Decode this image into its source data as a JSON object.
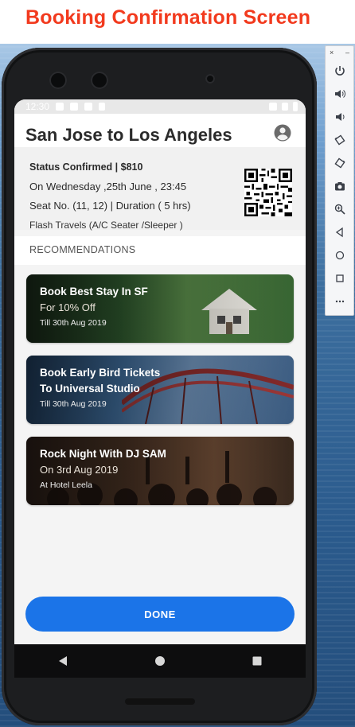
{
  "page_title": "Booking Confirmation Screen",
  "colors": {
    "title_red": "#f23a1e",
    "accent_blue": "#1b74e8"
  },
  "status_bar": {
    "time": "12:30"
  },
  "header": {
    "route": "San Jose to Los Angeles",
    "account_icon": "account-circle-icon"
  },
  "booking": {
    "status_line": "Status Confirmed | $810",
    "date_line": "On Wednesday ,25th June , 23:45",
    "seat_line": "Seat No. (11, 12) | Duration ( 5 hrs)",
    "operator_line": "Flash Travels (A/C Seater /Sleeper )",
    "qr_icon": "qr-code-icon"
  },
  "recommendations": {
    "label": "RECOMMENDATIONS",
    "cards": [
      {
        "title": "Book Best Stay In SF",
        "subtitle": "For 10% Off",
        "detail": "Till 30th Aug 2019"
      },
      {
        "title": "Book Early Bird Tickets",
        "subtitle": "To Universal Studio",
        "detail": "Till 30th Aug 2019"
      },
      {
        "title": "Rock Night With DJ SAM",
        "subtitle": "On 3rd Aug 2019",
        "detail": "At Hotel Leela"
      }
    ]
  },
  "done_button": "DONE",
  "emulator_toolbar": {
    "items": [
      "power-icon",
      "volume-up-icon",
      "volume-down-icon",
      "rotate-left-icon",
      "rotate-right-icon",
      "camera-icon",
      "zoom-icon",
      "back-icon",
      "home-icon",
      "overview-icon",
      "more-icon"
    ]
  },
  "nav_bar": {
    "items": [
      "back-triangle-icon",
      "home-circle-icon",
      "recents-square-icon"
    ]
  }
}
